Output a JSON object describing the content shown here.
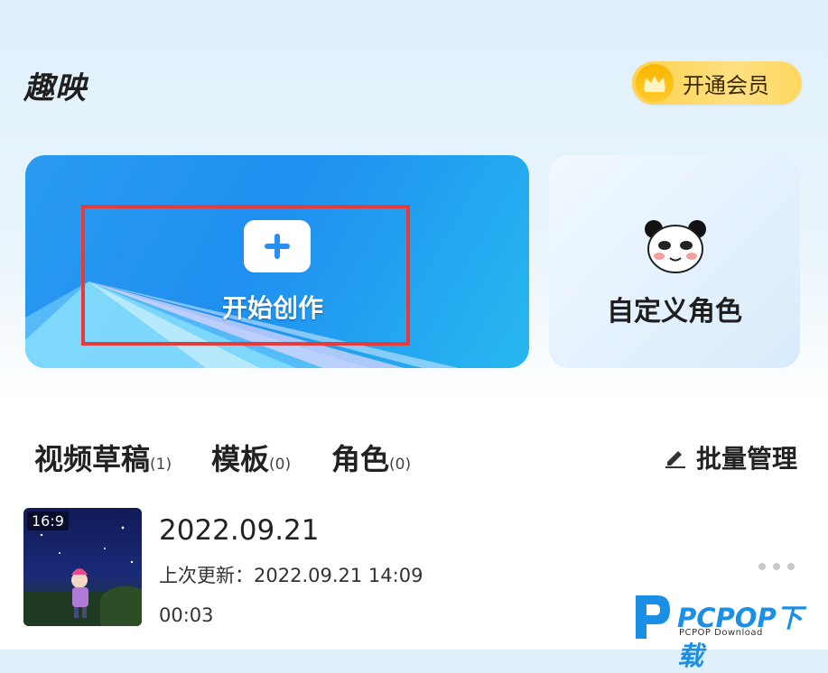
{
  "header": {
    "app_title": "趣映",
    "vip_label": "开通会员"
  },
  "cards": {
    "create_label": "开始创作",
    "character_label": "自定义角色"
  },
  "tabs": [
    {
      "label": "视频草稿",
      "count": "(1)"
    },
    {
      "label": "模板",
      "count": "(0)"
    },
    {
      "label": "角色",
      "count": "(0)"
    }
  ],
  "batch_manage_label": "批量管理",
  "draft": {
    "ratio": "16:9",
    "title": "2022.09.21",
    "updated": "上次更新：2022.09.21 14:09",
    "duration": "00:03"
  },
  "watermark": {
    "brand": "PCPOP下载",
    "sub": "PCPOP Download"
  },
  "colors": {
    "accent": "#1f8ff0",
    "highlight": "#e53b3b",
    "vip_gold": "#ffd24a",
    "watermark_blue": "#1b8fe6"
  },
  "icons": [
    "crown-icon",
    "plus-icon",
    "panda-icon",
    "pencil-icon",
    "more-dots-icon",
    "watermark-logo-icon"
  ]
}
